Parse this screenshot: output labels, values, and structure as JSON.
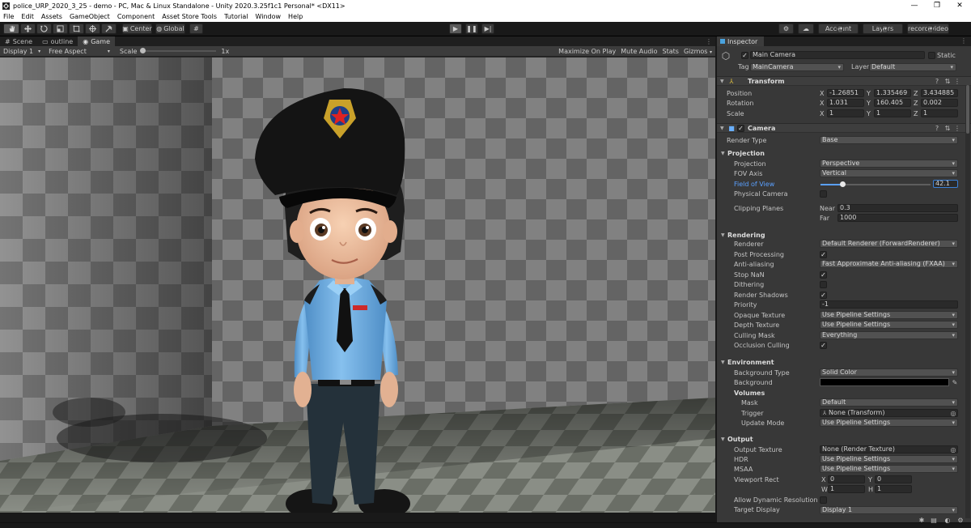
{
  "window": {
    "title": "police_URP_2020_3_25 - demo - PC, Mac & Linux Standalone - Unity 2020.3.25f1c1 Personal* <DX11>"
  },
  "menu": [
    "File",
    "Edit",
    "Assets",
    "GameObject",
    "Component",
    "Asset Store Tools",
    "Tutorial",
    "Window",
    "Help"
  ],
  "toolbar": {
    "center": "Center",
    "global": "Global",
    "account": "Account",
    "layers": "Layers",
    "layout": "record video"
  },
  "tabs": {
    "scene": "Scene",
    "outline": "outline",
    "game": "Game"
  },
  "game": {
    "display": "Display 1",
    "aspect": "Free Aspect",
    "scale_label": "Scale",
    "scale_value": "1x",
    "scale_fraction": 0.0,
    "maximize": "Maximize On Play",
    "mute": "Mute Audio",
    "stats": "Stats",
    "gizmos": "Gizmos"
  },
  "inspector": {
    "tab": "Inspector",
    "object": {
      "name": "Main Camera",
      "static": "Static",
      "tag_label": "Tag",
      "tag": "MainCamera",
      "layer_label": "Layer",
      "layer": "Default"
    },
    "transform": {
      "title": "Transform",
      "position": "Position",
      "rotation": "Rotation",
      "scale": "Scale",
      "pos": [
        "-1.26851",
        "1.335469",
        "3.434885"
      ],
      "rot": [
        "1.031",
        "160.405",
        "0.002"
      ],
      "scl": [
        "1",
        "1",
        "1"
      ]
    },
    "camera": {
      "title": "Camera",
      "render_type_label": "Render Type",
      "render_type": "Base"
    },
    "projection": {
      "header": "Projection",
      "projection_label": "Projection",
      "projection": "Perspective",
      "fov_axis_label": "FOV Axis",
      "fov_axis": "Vertical",
      "fov_label": "Field of View",
      "fov": "42.1",
      "fov_fraction": 0.2,
      "physical_label": "Physical Camera",
      "clip_label": "Clipping Planes",
      "near_label": "Near",
      "near": "0.3",
      "far_label": "Far",
      "far": "1000"
    },
    "rendering": {
      "header": "Rendering",
      "rows": [
        {
          "label": "Renderer",
          "kind": "dd",
          "value": "Default Renderer (ForwardRenderer)"
        },
        {
          "label": "Post Processing",
          "kind": "chk",
          "value": "✓"
        },
        {
          "label": "Anti-aliasing",
          "kind": "dd",
          "value": "Fast Approximate Anti-aliasing (FXAA)"
        },
        {
          "label": "Stop NaN",
          "kind": "chk",
          "value": "✓"
        },
        {
          "label": "Dithering",
          "kind": "chk",
          "value": ""
        },
        {
          "label": "Render Shadows",
          "kind": "chk",
          "value": "✓"
        },
        {
          "label": "Priority",
          "kind": "fld",
          "value": "-1"
        },
        {
          "label": "Opaque Texture",
          "kind": "dd",
          "value": "Use Pipeline Settings"
        },
        {
          "label": "Depth Texture",
          "kind": "dd",
          "value": "Use Pipeline Settings"
        },
        {
          "label": "Culling Mask",
          "kind": "dd",
          "value": "Everything"
        },
        {
          "label": "Occlusion Culling",
          "kind": "chk",
          "value": "✓"
        }
      ]
    },
    "environment": {
      "header": "Environment",
      "bg_type_label": "Background Type",
      "bg_type": "Solid Color",
      "bg_label": "Background",
      "bg_color": "#000000",
      "volumes": "Volumes",
      "mask_label": "Mask",
      "mask": "Default",
      "trigger_label": "Trigger",
      "trigger": "None (Transform)",
      "update_label": "Update Mode",
      "update": "Use Pipeline Settings"
    },
    "output": {
      "header": "Output",
      "texture_label": "Output Texture",
      "texture": "None (Render Texture)",
      "hdr_label": "HDR",
      "hdr": "Use Pipeline Settings",
      "msaa_label": "MSAA",
      "msaa": "Use Pipeline Settings",
      "rect_label": "Viewport Rect",
      "x": "0",
      "y": "0",
      "w": "1",
      "h": "1",
      "dyn_label": "Allow Dynamic Resolution",
      "target_label": "Target Display",
      "target": "Display 1"
    }
  }
}
